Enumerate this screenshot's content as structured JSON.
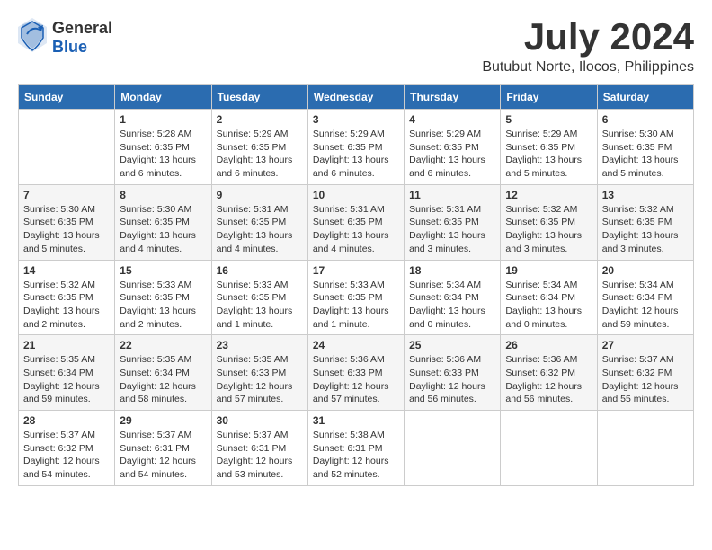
{
  "logo": {
    "text_general": "General",
    "text_blue": "Blue"
  },
  "title": "July 2024",
  "subtitle": "Butubut Norte, Ilocos, Philippines",
  "calendar": {
    "headers": [
      "Sunday",
      "Monday",
      "Tuesday",
      "Wednesday",
      "Thursday",
      "Friday",
      "Saturday"
    ],
    "weeks": [
      [
        {
          "day": "",
          "content": ""
        },
        {
          "day": "1",
          "content": "Sunrise: 5:28 AM\nSunset: 6:35 PM\nDaylight: 13 hours\nand 6 minutes."
        },
        {
          "day": "2",
          "content": "Sunrise: 5:29 AM\nSunset: 6:35 PM\nDaylight: 13 hours\nand 6 minutes."
        },
        {
          "day": "3",
          "content": "Sunrise: 5:29 AM\nSunset: 6:35 PM\nDaylight: 13 hours\nand 6 minutes."
        },
        {
          "day": "4",
          "content": "Sunrise: 5:29 AM\nSunset: 6:35 PM\nDaylight: 13 hours\nand 6 minutes."
        },
        {
          "day": "5",
          "content": "Sunrise: 5:29 AM\nSunset: 6:35 PM\nDaylight: 13 hours\nand 5 minutes."
        },
        {
          "day": "6",
          "content": "Sunrise: 5:30 AM\nSunset: 6:35 PM\nDaylight: 13 hours\nand 5 minutes."
        }
      ],
      [
        {
          "day": "7",
          "content": "Sunrise: 5:30 AM\nSunset: 6:35 PM\nDaylight: 13 hours\nand 5 minutes."
        },
        {
          "day": "8",
          "content": "Sunrise: 5:30 AM\nSunset: 6:35 PM\nDaylight: 13 hours\nand 4 minutes."
        },
        {
          "day": "9",
          "content": "Sunrise: 5:31 AM\nSunset: 6:35 PM\nDaylight: 13 hours\nand 4 minutes."
        },
        {
          "day": "10",
          "content": "Sunrise: 5:31 AM\nSunset: 6:35 PM\nDaylight: 13 hours\nand 4 minutes."
        },
        {
          "day": "11",
          "content": "Sunrise: 5:31 AM\nSunset: 6:35 PM\nDaylight: 13 hours\nand 3 minutes."
        },
        {
          "day": "12",
          "content": "Sunrise: 5:32 AM\nSunset: 6:35 PM\nDaylight: 13 hours\nand 3 minutes."
        },
        {
          "day": "13",
          "content": "Sunrise: 5:32 AM\nSunset: 6:35 PM\nDaylight: 13 hours\nand 3 minutes."
        }
      ],
      [
        {
          "day": "14",
          "content": "Sunrise: 5:32 AM\nSunset: 6:35 PM\nDaylight: 13 hours\nand 2 minutes."
        },
        {
          "day": "15",
          "content": "Sunrise: 5:33 AM\nSunset: 6:35 PM\nDaylight: 13 hours\nand 2 minutes."
        },
        {
          "day": "16",
          "content": "Sunrise: 5:33 AM\nSunset: 6:35 PM\nDaylight: 13 hours\nand 1 minute."
        },
        {
          "day": "17",
          "content": "Sunrise: 5:33 AM\nSunset: 6:35 PM\nDaylight: 13 hours\nand 1 minute."
        },
        {
          "day": "18",
          "content": "Sunrise: 5:34 AM\nSunset: 6:34 PM\nDaylight: 13 hours\nand 0 minutes."
        },
        {
          "day": "19",
          "content": "Sunrise: 5:34 AM\nSunset: 6:34 PM\nDaylight: 13 hours\nand 0 minutes."
        },
        {
          "day": "20",
          "content": "Sunrise: 5:34 AM\nSunset: 6:34 PM\nDaylight: 12 hours\nand 59 minutes."
        }
      ],
      [
        {
          "day": "21",
          "content": "Sunrise: 5:35 AM\nSunset: 6:34 PM\nDaylight: 12 hours\nand 59 minutes."
        },
        {
          "day": "22",
          "content": "Sunrise: 5:35 AM\nSunset: 6:34 PM\nDaylight: 12 hours\nand 58 minutes."
        },
        {
          "day": "23",
          "content": "Sunrise: 5:35 AM\nSunset: 6:33 PM\nDaylight: 12 hours\nand 57 minutes."
        },
        {
          "day": "24",
          "content": "Sunrise: 5:36 AM\nSunset: 6:33 PM\nDaylight: 12 hours\nand 57 minutes."
        },
        {
          "day": "25",
          "content": "Sunrise: 5:36 AM\nSunset: 6:33 PM\nDaylight: 12 hours\nand 56 minutes."
        },
        {
          "day": "26",
          "content": "Sunrise: 5:36 AM\nSunset: 6:32 PM\nDaylight: 12 hours\nand 56 minutes."
        },
        {
          "day": "27",
          "content": "Sunrise: 5:37 AM\nSunset: 6:32 PM\nDaylight: 12 hours\nand 55 minutes."
        }
      ],
      [
        {
          "day": "28",
          "content": "Sunrise: 5:37 AM\nSunset: 6:32 PM\nDaylight: 12 hours\nand 54 minutes."
        },
        {
          "day": "29",
          "content": "Sunrise: 5:37 AM\nSunset: 6:31 PM\nDaylight: 12 hours\nand 54 minutes."
        },
        {
          "day": "30",
          "content": "Sunrise: 5:37 AM\nSunset: 6:31 PM\nDaylight: 12 hours\nand 53 minutes."
        },
        {
          "day": "31",
          "content": "Sunrise: 5:38 AM\nSunset: 6:31 PM\nDaylight: 12 hours\nand 52 minutes."
        },
        {
          "day": "",
          "content": ""
        },
        {
          "day": "",
          "content": ""
        },
        {
          "day": "",
          "content": ""
        }
      ]
    ]
  }
}
